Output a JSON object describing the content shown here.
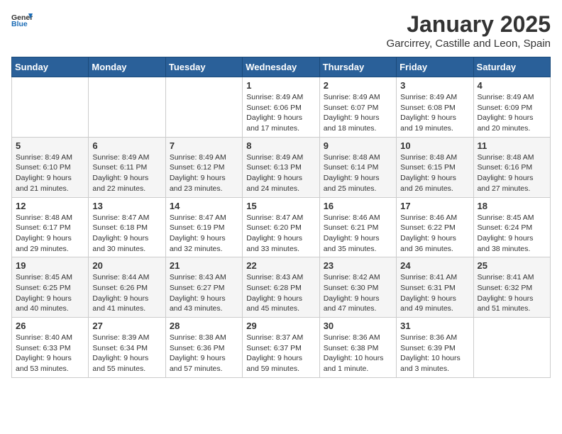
{
  "header": {
    "logo_general": "General",
    "logo_blue": "Blue",
    "month": "January 2025",
    "location": "Garcirrey, Castille and Leon, Spain"
  },
  "weekdays": [
    "Sunday",
    "Monday",
    "Tuesday",
    "Wednesday",
    "Thursday",
    "Friday",
    "Saturday"
  ],
  "weeks": [
    [
      {
        "day": "",
        "info": ""
      },
      {
        "day": "",
        "info": ""
      },
      {
        "day": "",
        "info": ""
      },
      {
        "day": "1",
        "info": "Sunrise: 8:49 AM\nSunset: 6:06 PM\nDaylight: 9 hours and 17 minutes."
      },
      {
        "day": "2",
        "info": "Sunrise: 8:49 AM\nSunset: 6:07 PM\nDaylight: 9 hours and 18 minutes."
      },
      {
        "day": "3",
        "info": "Sunrise: 8:49 AM\nSunset: 6:08 PM\nDaylight: 9 hours and 19 minutes."
      },
      {
        "day": "4",
        "info": "Sunrise: 8:49 AM\nSunset: 6:09 PM\nDaylight: 9 hours and 20 minutes."
      }
    ],
    [
      {
        "day": "5",
        "info": "Sunrise: 8:49 AM\nSunset: 6:10 PM\nDaylight: 9 hours and 21 minutes."
      },
      {
        "day": "6",
        "info": "Sunrise: 8:49 AM\nSunset: 6:11 PM\nDaylight: 9 hours and 22 minutes."
      },
      {
        "day": "7",
        "info": "Sunrise: 8:49 AM\nSunset: 6:12 PM\nDaylight: 9 hours and 23 minutes."
      },
      {
        "day": "8",
        "info": "Sunrise: 8:49 AM\nSunset: 6:13 PM\nDaylight: 9 hours and 24 minutes."
      },
      {
        "day": "9",
        "info": "Sunrise: 8:48 AM\nSunset: 6:14 PM\nDaylight: 9 hours and 25 minutes."
      },
      {
        "day": "10",
        "info": "Sunrise: 8:48 AM\nSunset: 6:15 PM\nDaylight: 9 hours and 26 minutes."
      },
      {
        "day": "11",
        "info": "Sunrise: 8:48 AM\nSunset: 6:16 PM\nDaylight: 9 hours and 27 minutes."
      }
    ],
    [
      {
        "day": "12",
        "info": "Sunrise: 8:48 AM\nSunset: 6:17 PM\nDaylight: 9 hours and 29 minutes."
      },
      {
        "day": "13",
        "info": "Sunrise: 8:47 AM\nSunset: 6:18 PM\nDaylight: 9 hours and 30 minutes."
      },
      {
        "day": "14",
        "info": "Sunrise: 8:47 AM\nSunset: 6:19 PM\nDaylight: 9 hours and 32 minutes."
      },
      {
        "day": "15",
        "info": "Sunrise: 8:47 AM\nSunset: 6:20 PM\nDaylight: 9 hours and 33 minutes."
      },
      {
        "day": "16",
        "info": "Sunrise: 8:46 AM\nSunset: 6:21 PM\nDaylight: 9 hours and 35 minutes."
      },
      {
        "day": "17",
        "info": "Sunrise: 8:46 AM\nSunset: 6:22 PM\nDaylight: 9 hours and 36 minutes."
      },
      {
        "day": "18",
        "info": "Sunrise: 8:45 AM\nSunset: 6:24 PM\nDaylight: 9 hours and 38 minutes."
      }
    ],
    [
      {
        "day": "19",
        "info": "Sunrise: 8:45 AM\nSunset: 6:25 PM\nDaylight: 9 hours and 40 minutes."
      },
      {
        "day": "20",
        "info": "Sunrise: 8:44 AM\nSunset: 6:26 PM\nDaylight: 9 hours and 41 minutes."
      },
      {
        "day": "21",
        "info": "Sunrise: 8:43 AM\nSunset: 6:27 PM\nDaylight: 9 hours and 43 minutes."
      },
      {
        "day": "22",
        "info": "Sunrise: 8:43 AM\nSunset: 6:28 PM\nDaylight: 9 hours and 45 minutes."
      },
      {
        "day": "23",
        "info": "Sunrise: 8:42 AM\nSunset: 6:30 PM\nDaylight: 9 hours and 47 minutes."
      },
      {
        "day": "24",
        "info": "Sunrise: 8:41 AM\nSunset: 6:31 PM\nDaylight: 9 hours and 49 minutes."
      },
      {
        "day": "25",
        "info": "Sunrise: 8:41 AM\nSunset: 6:32 PM\nDaylight: 9 hours and 51 minutes."
      }
    ],
    [
      {
        "day": "26",
        "info": "Sunrise: 8:40 AM\nSunset: 6:33 PM\nDaylight: 9 hours and 53 minutes."
      },
      {
        "day": "27",
        "info": "Sunrise: 8:39 AM\nSunset: 6:34 PM\nDaylight: 9 hours and 55 minutes."
      },
      {
        "day": "28",
        "info": "Sunrise: 8:38 AM\nSunset: 6:36 PM\nDaylight: 9 hours and 57 minutes."
      },
      {
        "day": "29",
        "info": "Sunrise: 8:37 AM\nSunset: 6:37 PM\nDaylight: 9 hours and 59 minutes."
      },
      {
        "day": "30",
        "info": "Sunrise: 8:36 AM\nSunset: 6:38 PM\nDaylight: 10 hours and 1 minute."
      },
      {
        "day": "31",
        "info": "Sunrise: 8:36 AM\nSunset: 6:39 PM\nDaylight: 10 hours and 3 minutes."
      },
      {
        "day": "",
        "info": ""
      }
    ]
  ]
}
